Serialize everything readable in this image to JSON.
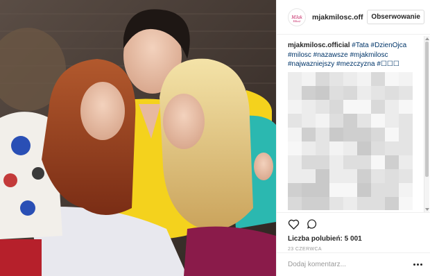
{
  "post": {
    "photo_icon": "post-photo"
  },
  "header": {
    "avatar_icon": "profile-avatar",
    "avatar_text": "MJakMiłość",
    "username": "mjakmilosc.off",
    "follow_label": "Obserwowanie"
  },
  "caption": {
    "user": "mjakmilosc.official",
    "tags": "#Tata #DzienOjca #milosc #nazawsze #mjakmilosc #najwazniejszy #mezczyzna #☐☐☐"
  },
  "actions": {
    "like_icon": "heart-icon",
    "comment_icon": "comment-icon",
    "likes_text": "Liczba polubień: 5 001",
    "date_text": "23 CZERWCA"
  },
  "comment_box": {
    "placeholder": "Dodaj komentarz...",
    "more_icon": "more-options-icon"
  },
  "colors": {
    "hashtag": "#003569",
    "border": "#efefef",
    "muted": "#999999",
    "accent_logo": "#c2185b"
  }
}
